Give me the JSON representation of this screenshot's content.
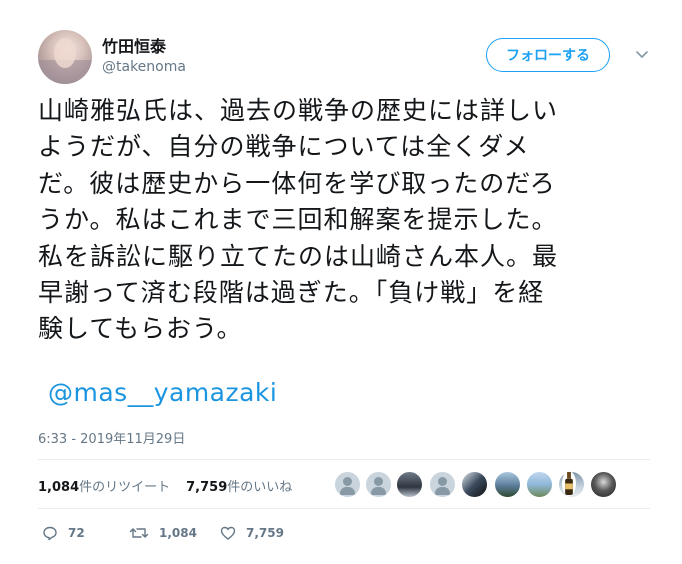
{
  "author": {
    "display_name": "竹田恒泰",
    "handle": "@takenoma"
  },
  "follow_button_label": "フォローする",
  "tweet": {
    "lines": [
      "山崎雅弘氏は、過去の戦争の歴史には詳しい",
      "ようだが、自分の戦争については全くダメ",
      "だ。彼は歴史から一体何を学び取ったのだろ",
      "うか。私はこれまで三回和解案を提示した。",
      "私を訴訟に駆り立てたのは山崎さん本人。最",
      "早謝って済む段階は過ぎた。「負け戦」を経",
      "験してもらおう。"
    ],
    "mention": "@mas__yamazaki",
    "timestamp": "6:33 - 2019年11月29日"
  },
  "stats": {
    "retweets_count": "1,084",
    "retweets_label": "件のリツイート",
    "likes_count": "7,759",
    "likes_label": "件のいいね"
  },
  "actions": {
    "reply_count": "72",
    "retweet_count": "1,084",
    "like_count": "7,759"
  },
  "colors": {
    "accent": "#1da1f2",
    "link": "#1b95e0",
    "muted": "#657786",
    "divider": "#e6ecf0"
  },
  "icons": [
    "chevron-down-icon",
    "reply-icon",
    "retweet-icon",
    "heart-icon"
  ]
}
